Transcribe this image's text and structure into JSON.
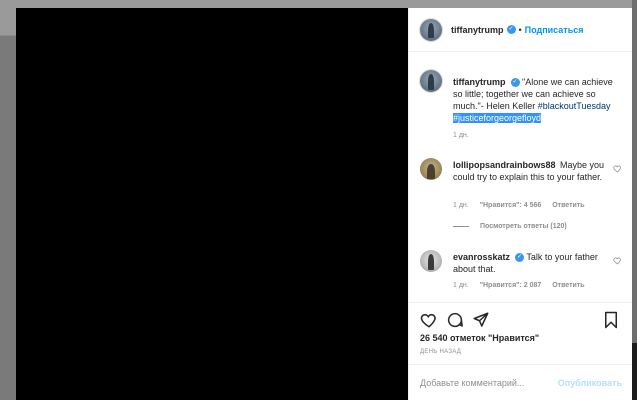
{
  "post": {
    "username": "tiffanytrump",
    "follow_label": "Подписаться",
    "separator": "•"
  },
  "comments": [
    {
      "username": "tiffanytrump",
      "text": "\"Alone we can achieve so little; together we can achieve so much.\"- Helen Keller",
      "hashtag1": "#blackoutTuesday",
      "hashtag2": "#justiceforgeorgefloyd",
      "time": "1 дн."
    },
    {
      "username": "lollipopsandrainbows88",
      "text": "Maybe you could try to explain this to your father.",
      "time": "1 дн.",
      "likes": "\"Нравится\": 4 566",
      "reply": "Ответить",
      "view_replies": "Посмотреть ответы (120)"
    },
    {
      "username": "evanrosskatz",
      "text": "Talk to your father about that.",
      "time": "1 дн.",
      "likes": "\"Нравится\": 2 087",
      "reply": "Ответить"
    }
  ],
  "actions": {
    "likes_count": "26 540 отметок \"Нравится\"",
    "date": "ДЕНЬ НАЗАД"
  },
  "comment_box": {
    "placeholder": "Добавьте комментарий...",
    "post_label": "Опубликовать"
  },
  "icons": {
    "verified": "verified-badge-icon",
    "heart": "heart-icon",
    "comment": "comment-icon",
    "share": "share-icon",
    "bookmark": "bookmark-icon"
  },
  "colors": {
    "link": "#0095f6",
    "hashtag": "#00376b",
    "muted": "#8e8e8e",
    "post_disabled": "#b2dffc"
  }
}
